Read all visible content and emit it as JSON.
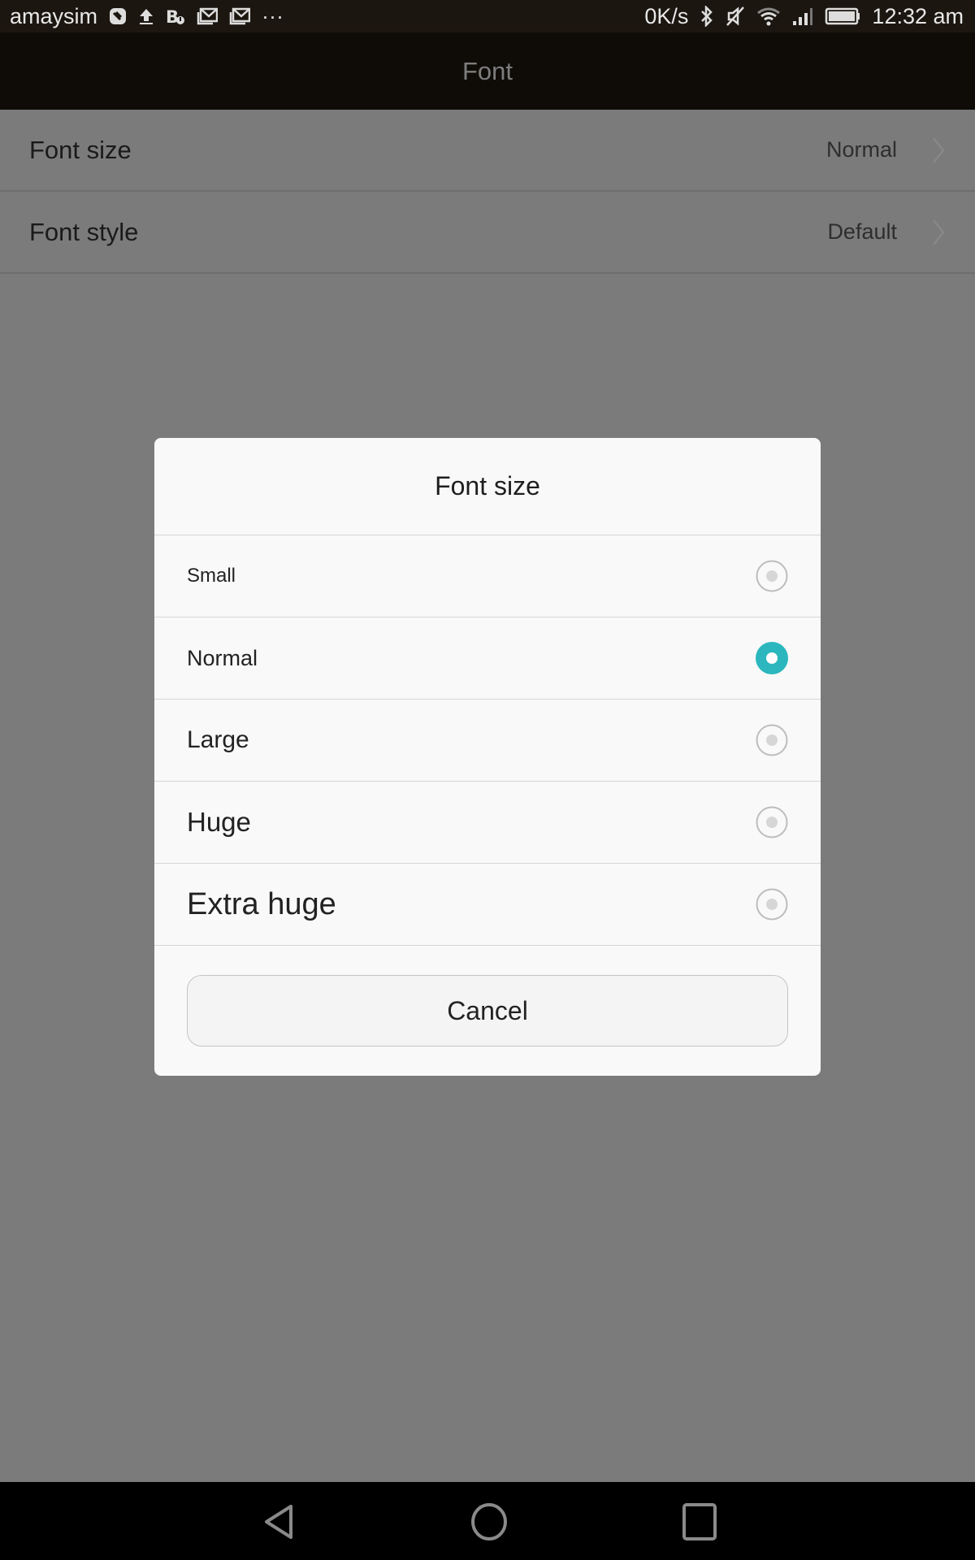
{
  "status_bar": {
    "carrier": "amaysim",
    "left_icons": [
      "sync-icon",
      "upload-icon",
      "notification-b-icon",
      "mail-icon",
      "mail-icon",
      "more-icon"
    ],
    "more_glyph": "···",
    "net_speed": "0K/s",
    "right_icons": [
      "bluetooth-icon",
      "mute-icon",
      "wifi-icon",
      "signal-icon",
      "battery-icon"
    ],
    "time": "12:32 am"
  },
  "header": {
    "title": "Font"
  },
  "settings": {
    "items": [
      {
        "label": "Font size",
        "value": "Normal"
      },
      {
        "label": "Font style",
        "value": "Default"
      }
    ]
  },
  "dialog": {
    "title": "Font size",
    "options": [
      {
        "label": "Small",
        "selected": false
      },
      {
        "label": "Normal",
        "selected": true
      },
      {
        "label": "Large",
        "selected": false
      },
      {
        "label": "Huge",
        "selected": false
      },
      {
        "label": "Extra huge",
        "selected": false
      }
    ],
    "cancel_label": "Cancel",
    "accent_color": "#2bb7bd"
  },
  "nav_bar": {
    "buttons": [
      "back",
      "home",
      "recents"
    ]
  }
}
